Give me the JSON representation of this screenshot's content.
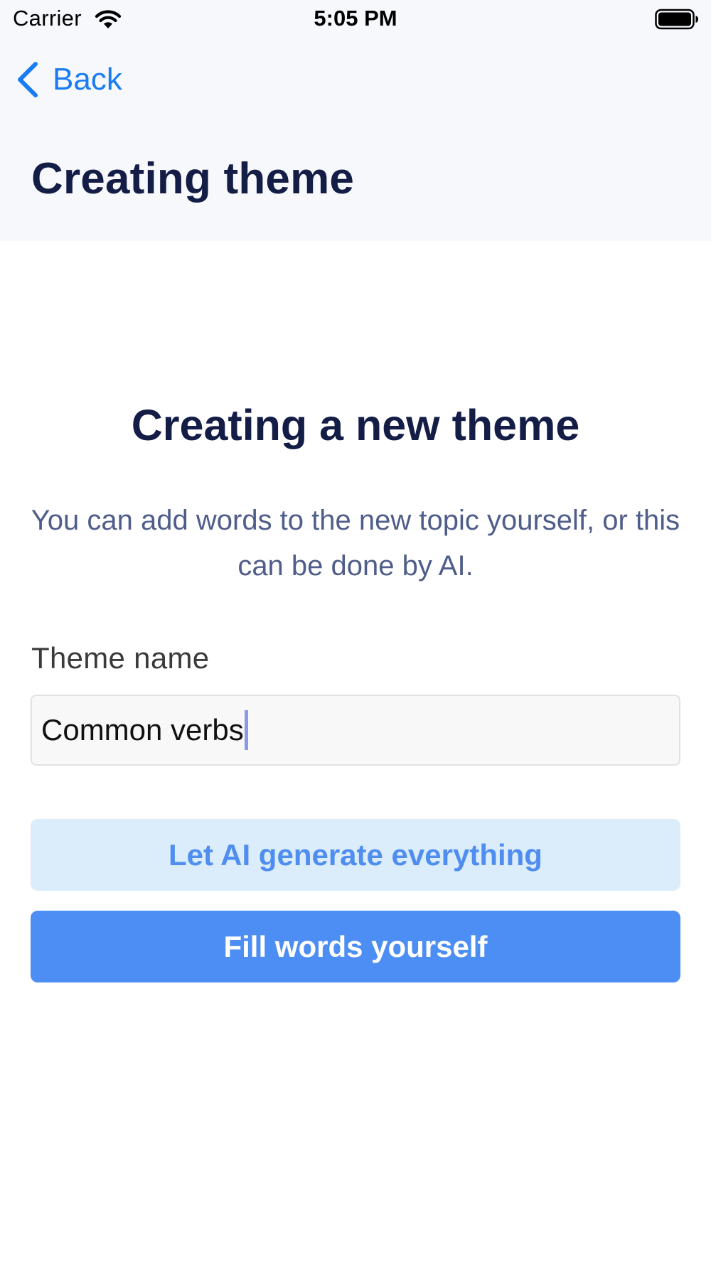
{
  "status_bar": {
    "carrier": "Carrier",
    "time": "5:05 PM",
    "wifi_icon": "wifi-icon",
    "battery_icon": "battery-icon"
  },
  "nav": {
    "back_label": "Back",
    "back_icon": "chevron-left-icon",
    "title": "Creating theme"
  },
  "main": {
    "title": "Creating a new theme",
    "description": "You can add words to the new topic yourself, or this can be done by AI.",
    "theme_name": {
      "label": "Theme name",
      "value": "Common verbs"
    },
    "buttons": {
      "ai_generate": "Let AI generate everything",
      "fill_yourself": "Fill words yourself"
    }
  },
  "colors": {
    "accent": "#4d8ef4",
    "accent_light": "#dbecfb",
    "link": "#1a7cf2",
    "title": "#141d45",
    "description": "#4f5d8a"
  }
}
